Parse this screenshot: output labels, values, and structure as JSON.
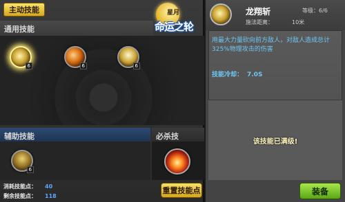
{
  "left": {
    "tab_main": "主动技能",
    "logo": {
      "moon": "星月",
      "text": "命运之轮"
    },
    "section_common": "通用技能",
    "section_support": "辅助技能",
    "section_ultimate": "必杀技",
    "common_skills": [
      {
        "level": "6",
        "icon": "sword-slash-icon"
      },
      {
        "level": "6",
        "icon": "whirl-strike-icon"
      },
      {
        "level": "6",
        "icon": "tornado-icon"
      }
    ],
    "support_skills": [
      {
        "level": "6",
        "icon": "hooded-figure-icon"
      }
    ],
    "ultimate_skills": [
      {
        "icon": "explosion-icon"
      }
    ],
    "points": {
      "consumed_label": "消耗技能点：",
      "consumed_value": "40",
      "remaining_label": "剩余技能点：",
      "remaining_value": "118"
    },
    "reset_button": "重置技能点"
  },
  "detail": {
    "name": "龙翔斩",
    "level_label": "等级：",
    "level_value": "6/6",
    "range_label": "施法距离：",
    "range_value": "10米",
    "description": "用最大力量砍向前方敌人，对敌人造成总计325%物理攻击的伤害",
    "cooldown_label": "技能冷却：",
    "cooldown_value": "7.0S",
    "maxed_text": "该技能已满级!",
    "equip_button": "装备"
  },
  "colors": {
    "highlight": "#ffe86a",
    "description": "#6fc7f5",
    "cooldown": "#6fc7f5",
    "points_value": "#5aa8ff"
  }
}
